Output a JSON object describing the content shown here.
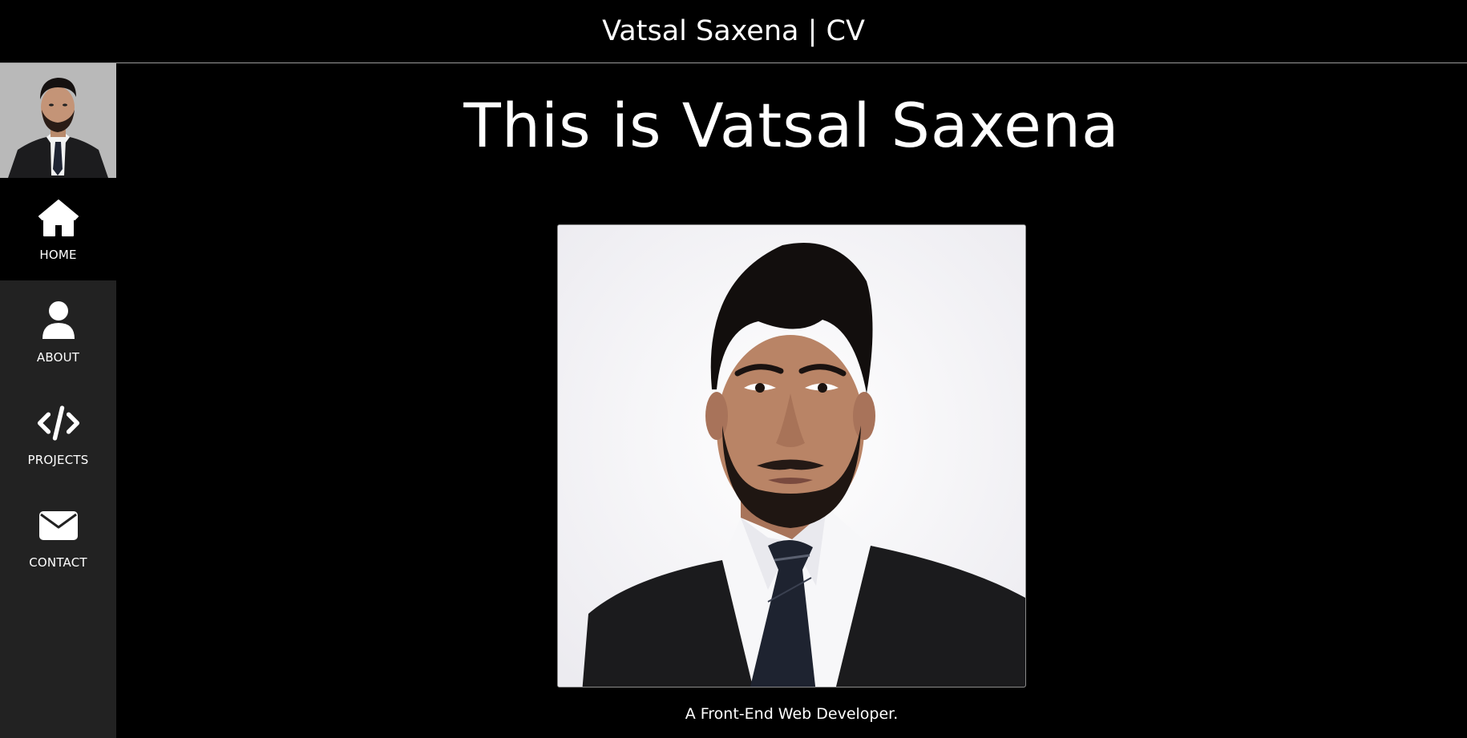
{
  "header": {
    "title": "Vatsal Saxena | CV"
  },
  "sidebar": {
    "avatar_icon": "profile-photo",
    "items": [
      {
        "label": "HOME",
        "icon": "home-icon",
        "active": true
      },
      {
        "label": "ABOUT",
        "icon": "user-icon",
        "active": false
      },
      {
        "label": "PROJECTS",
        "icon": "code-icon",
        "active": false
      },
      {
        "label": "CONTACT",
        "icon": "envelope-icon",
        "active": false
      }
    ]
  },
  "main": {
    "headline": "This is Vatsal Saxena",
    "tagline": "A Front-End Web Developer.",
    "portrait_icon": "portrait-photo"
  },
  "colors": {
    "background": "#000000",
    "sidebar": "#222222",
    "active_item": "#000000",
    "text": "#ffffff",
    "divider": "#9a9a9a"
  }
}
